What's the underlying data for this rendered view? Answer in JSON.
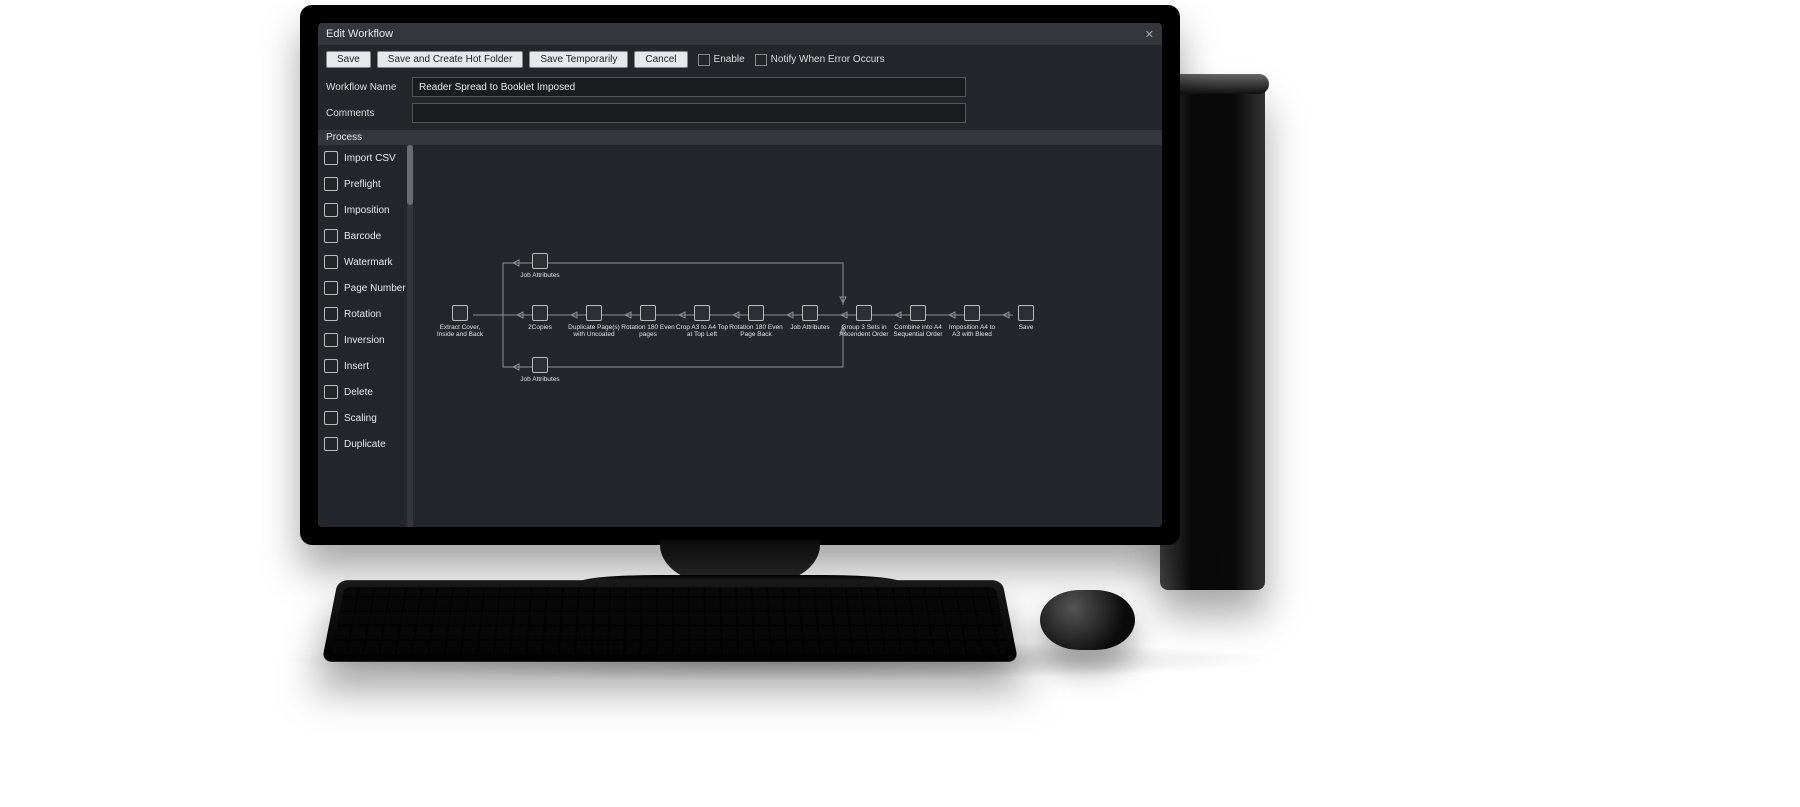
{
  "window": {
    "title": "Edit Workflow"
  },
  "toolbar": {
    "save": "Save",
    "save_hot": "Save and Create Hot Folder",
    "save_temp": "Save Temporarily",
    "cancel": "Cancel",
    "enable": "Enable",
    "notify": "Notify When Error Occurs"
  },
  "form": {
    "name_label": "Workflow Name",
    "name_value": "Reader Spread to Booklet Imposed",
    "comments_label": "Comments",
    "comments_value": ""
  },
  "section": {
    "process": "Process"
  },
  "sidebar": [
    "Import CSV",
    "Preflight",
    "Imposition",
    "Barcode",
    "Watermark",
    "Page Number",
    "Rotation",
    "Inversion",
    "Insert",
    "Delete",
    "Scaling",
    "Duplicate"
  ],
  "nodes": {
    "n0": "Extract Cover, Inside and Back",
    "n1": "2Copies",
    "n2": "Duplicate Page(s) with Uncoated",
    "n3": "Rotation 180 Even pages",
    "n4": "Crop A3 to A4 Top at Top Left",
    "n5": "Rotation 180 Even Page Back",
    "n6": "Job Attributes",
    "n7": "Group 3 Sets in Ascendent Order",
    "n8": "Combine into A4 Sequential Order",
    "n9": "Imposition A4 to A3 with Bleed",
    "n10": "Save",
    "nTop": "Job Attributes",
    "nBot": "Job Attributes"
  }
}
